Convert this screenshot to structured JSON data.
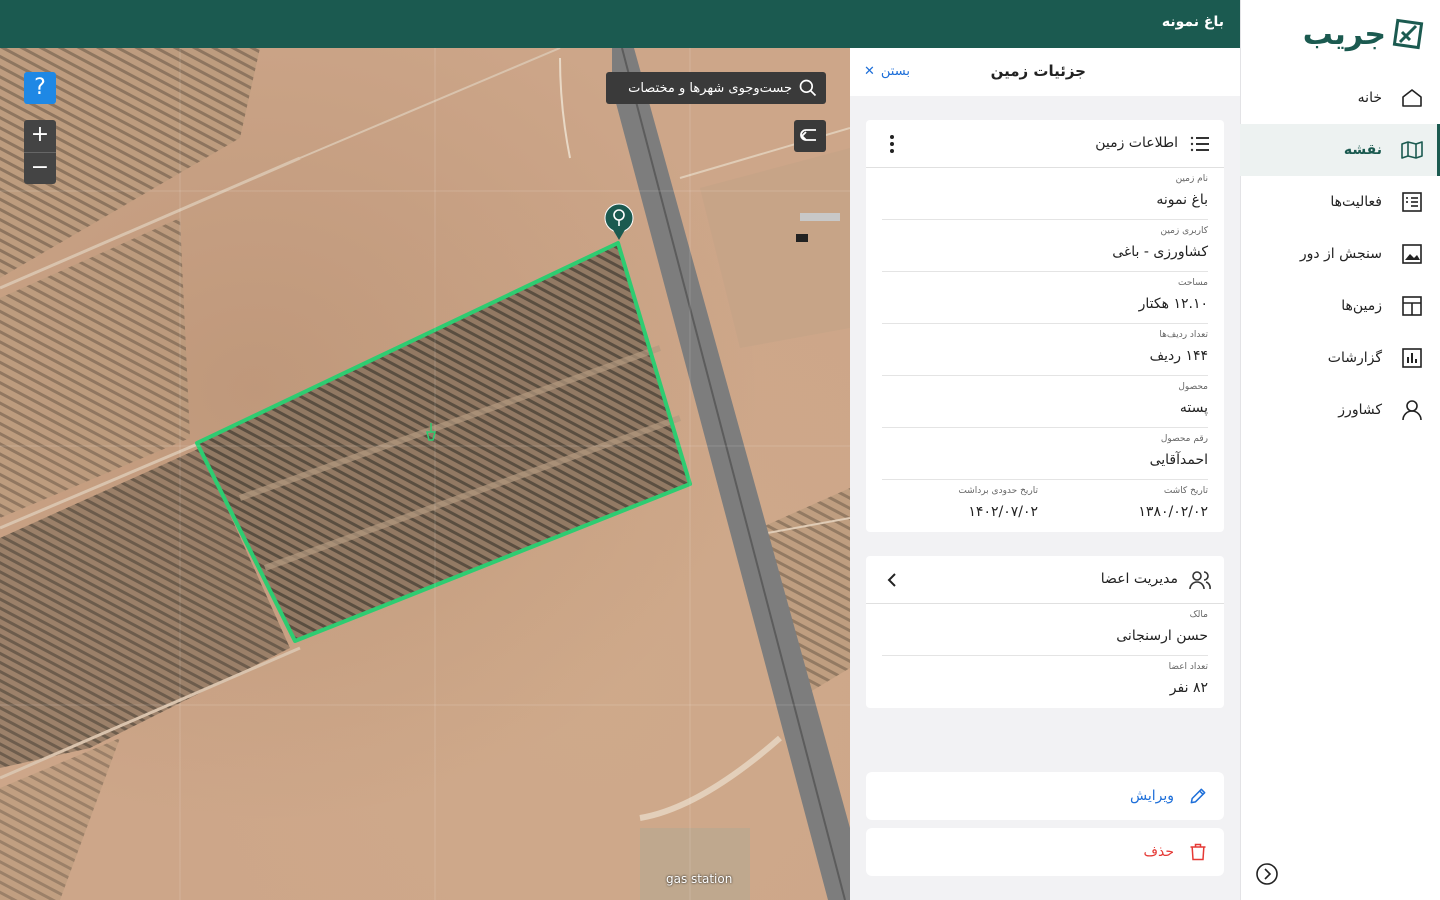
{
  "topbar": {
    "title": "باغ نمونه"
  },
  "sidebar": {
    "logo_text": "جریب",
    "items": [
      {
        "label": "خانه",
        "icon": "home-icon",
        "active": false
      },
      {
        "label": "نقشه",
        "icon": "map-icon",
        "active": true
      },
      {
        "label": "فعالیت‌ها",
        "icon": "activities-icon",
        "active": false
      },
      {
        "label": "سنجش از دور",
        "icon": "image-icon",
        "active": false
      },
      {
        "label": "زمین‌ها",
        "icon": "layout-icon",
        "active": false
      },
      {
        "label": "گزارشات",
        "icon": "bar-chart-icon",
        "active": false
      },
      {
        "label": "کشاورز",
        "icon": "user-icon",
        "active": false
      }
    ]
  },
  "map": {
    "help_label": "?",
    "zoom_in": "+",
    "zoom_out": "−",
    "search_placeholder": "جست‌وجوی شهرها و مختصات",
    "poi_label": "gas station",
    "polygon_color": "#2ecc71"
  },
  "panel": {
    "title": "جزئیات زمین",
    "close_label": "بستن",
    "land_info": {
      "title": "اطلاعات زمین",
      "fields": [
        {
          "key": "نام زمین",
          "value": "باغ نمونه"
        },
        {
          "key": "کاربری زمین",
          "value": "کشاورزی - باغی"
        },
        {
          "key": "مساحت",
          "value": "۱۲.۱۰ هکتار"
        },
        {
          "key": "تعداد ردیف‌ها",
          "value": "۱۴۴ ردیف"
        },
        {
          "key": "محصول",
          "value": "پسته"
        },
        {
          "key": "رقم محصول",
          "value": "احمدآقایی"
        }
      ],
      "planting_date": {
        "key": "تاریخ کاشت",
        "value": "۱۳۸۰/۰۲/۰۲"
      },
      "harvest_date": {
        "key": "تاریخ حدودی برداشت",
        "value": "۱۴۰۲/۰۷/۰۲"
      }
    },
    "members": {
      "title": "مدیریت اعضا",
      "fields": [
        {
          "key": "مالک",
          "value": "حسن ارسنجانی"
        },
        {
          "key": "تعداد اعضا",
          "value": "۸۲ نفر"
        }
      ]
    },
    "edit_label": "ویرایش",
    "delete_label": "حذف"
  },
  "colors": {
    "brand": "#1b5a50",
    "link": "#1e6fd9",
    "danger": "#e53935"
  }
}
